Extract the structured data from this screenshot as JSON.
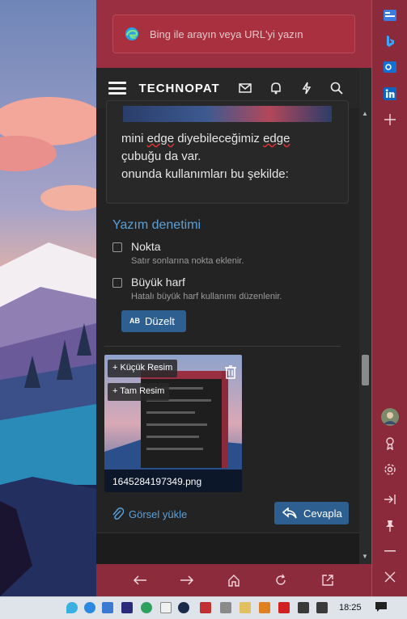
{
  "browser": {
    "address_placeholder": "Bing ile arayın veya URL'yi yazın"
  },
  "site": {
    "logo": "TECHNOPAT"
  },
  "post": {
    "line1_a": "mini ",
    "line1_u1": "edge",
    "line1_b": " diyebileceğimiz ",
    "line1_u2": "edge",
    "line2": "çubuğu da var.",
    "line3": "onunda kullanımları bu şekilde:"
  },
  "spellcheck": {
    "title": "Yazım denetimi",
    "options": [
      {
        "label": "Nokta",
        "desc": "Satır sonlarına nokta eklenir."
      },
      {
        "label": "Büyük harf",
        "desc": "Hatalı büyük harf kullanımı düzenlenir."
      }
    ],
    "fix_label": "Düzelt",
    "fix_icon_text": "AB"
  },
  "attachment": {
    "small_label": "+ Küçük Resim",
    "full_label": "+ Tam Resim",
    "filename": "1645284197349.png"
  },
  "actions": {
    "upload_label": "Görsel yükle",
    "reply_label": "Cevapla"
  },
  "taskbar": {
    "time": "18:25"
  },
  "colors": {
    "accent": "#2e5f91",
    "link": "#5aa0d8",
    "edge_chrome": "#8c2b3c"
  }
}
